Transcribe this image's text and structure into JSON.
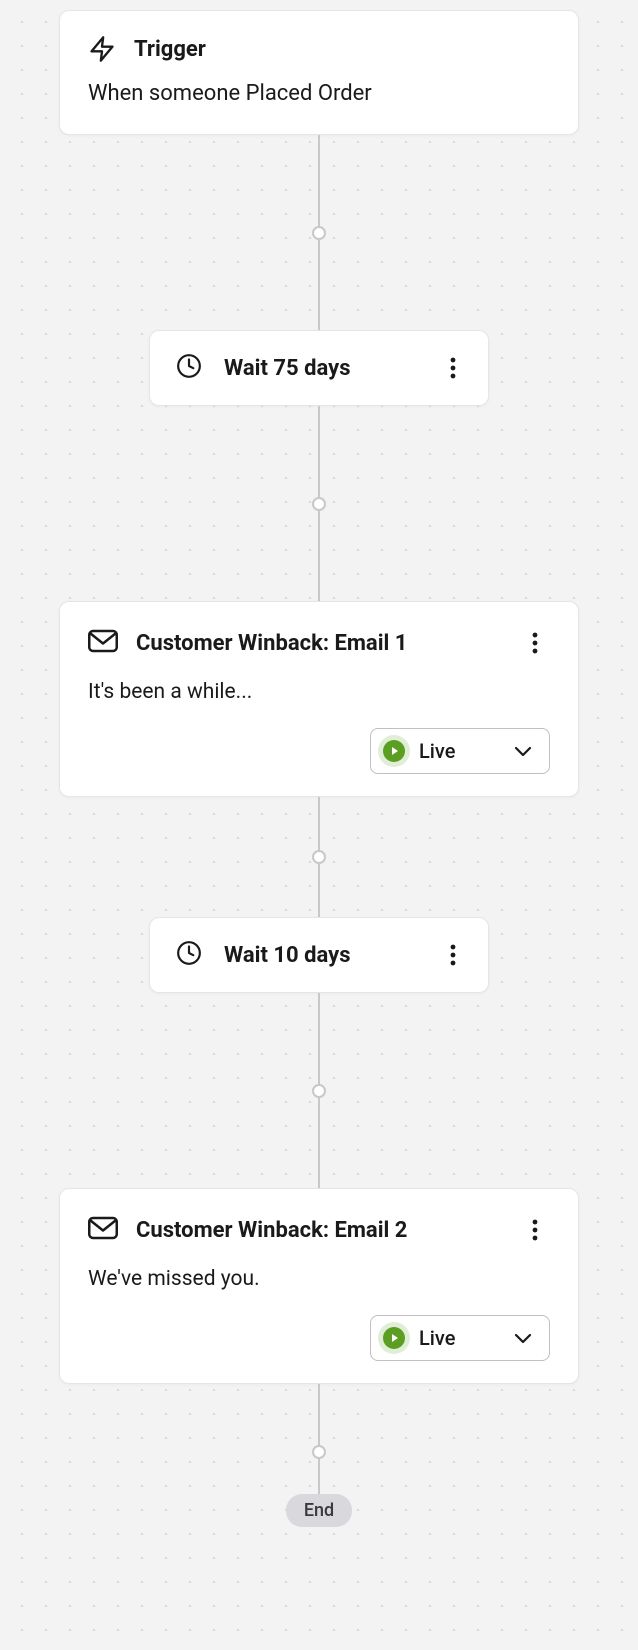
{
  "trigger": {
    "title": "Trigger",
    "description": "When someone Placed Order"
  },
  "steps": [
    {
      "type": "wait",
      "label": "Wait 75 days"
    },
    {
      "type": "email",
      "title": "Customer Winback: Email 1",
      "subject": "It's been a while...",
      "status": "Live"
    },
    {
      "type": "wait",
      "label": "Wait 10 days"
    },
    {
      "type": "email",
      "title": "Customer Winback: Email 2",
      "subject": "We've missed you.",
      "status": "Live"
    }
  ],
  "end_label": "End"
}
